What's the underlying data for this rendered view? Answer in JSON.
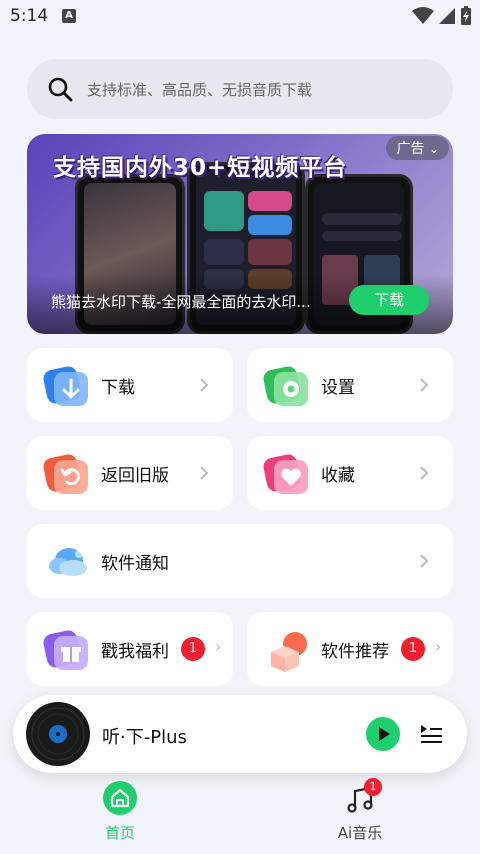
{
  "status_bar": {
    "time": "5:14",
    "notification_letter": "A"
  },
  "search": {
    "placeholder": "支持标准、高品质、无损音质下载"
  },
  "banner": {
    "title": "支持国内外30+短视频平台",
    "ad_label": "广告",
    "caption": "熊猫去水印下载-全网最全面的去水印...",
    "download_label": "下载"
  },
  "cards": {
    "download": {
      "label": "下载",
      "icon": "download-icon"
    },
    "settings": {
      "label": "设置",
      "icon": "gear-icon"
    },
    "old_version": {
      "label": "返回旧版",
      "icon": "undo-icon"
    },
    "favorites": {
      "label": "收藏",
      "icon": "heart-icon"
    },
    "notices": {
      "label": "软件通知",
      "icon": "cloud-icon"
    },
    "welfare": {
      "label": "戳我福利",
      "badge": "1",
      "icon": "gift-icon"
    },
    "recommend": {
      "label": "软件推荐",
      "badge": "1",
      "icon": "box-icon"
    }
  },
  "player": {
    "title": "听·下-Plus"
  },
  "bottom_nav": {
    "home": {
      "label": "首页",
      "active": true
    },
    "ai_music": {
      "label": "Ai音乐",
      "badge": "1"
    }
  },
  "colors": {
    "accent_green": "#1fcf6d",
    "badge_red": "#f0212e",
    "background": "#f3f4fb"
  }
}
